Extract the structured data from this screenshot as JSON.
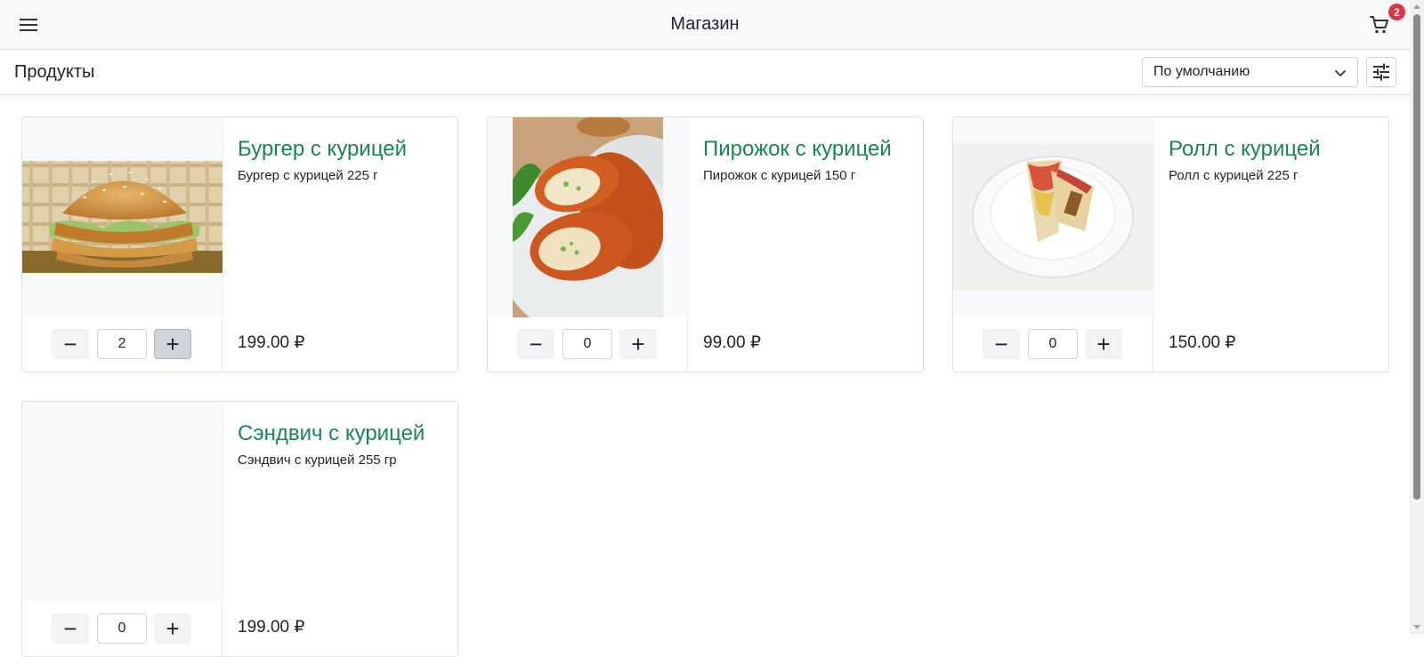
{
  "header": {
    "title": "Магазин",
    "menu_icon": "hamburger-menu-icon",
    "cart_icon": "shopping-cart-icon",
    "cart_count": "2"
  },
  "toolbar": {
    "page_title": "Продукты",
    "sort_value": "По умолчанию",
    "filter_icon": "tune-icon"
  },
  "colors": {
    "product_name": "#198754",
    "badge": "#dc3545"
  },
  "products": [
    {
      "name": "Бургер с курицей",
      "description": "Бургер с курицей 225 г",
      "price": "199.00 ₽",
      "quantity": "2",
      "image": "chicken-burger-photo"
    },
    {
      "name": "Пирожок с курицей",
      "description": "Пирожок с курицей 150 г",
      "price": "99.00 ₽",
      "quantity": "0",
      "image": "chicken-pie-photo"
    },
    {
      "name": "Ролл с курицей",
      "description": "Ролл с курицей 225 г",
      "price": "150.00 ₽",
      "quantity": "0",
      "image": "chicken-roll-photo"
    },
    {
      "name": "Сэндвич с курицей",
      "description": "Сэндвич с курицей 255 гр",
      "price": "199.00 ₽",
      "quantity": "0",
      "image": ""
    }
  ],
  "controls": {
    "minus_symbol": "−",
    "plus_symbol": "+"
  }
}
